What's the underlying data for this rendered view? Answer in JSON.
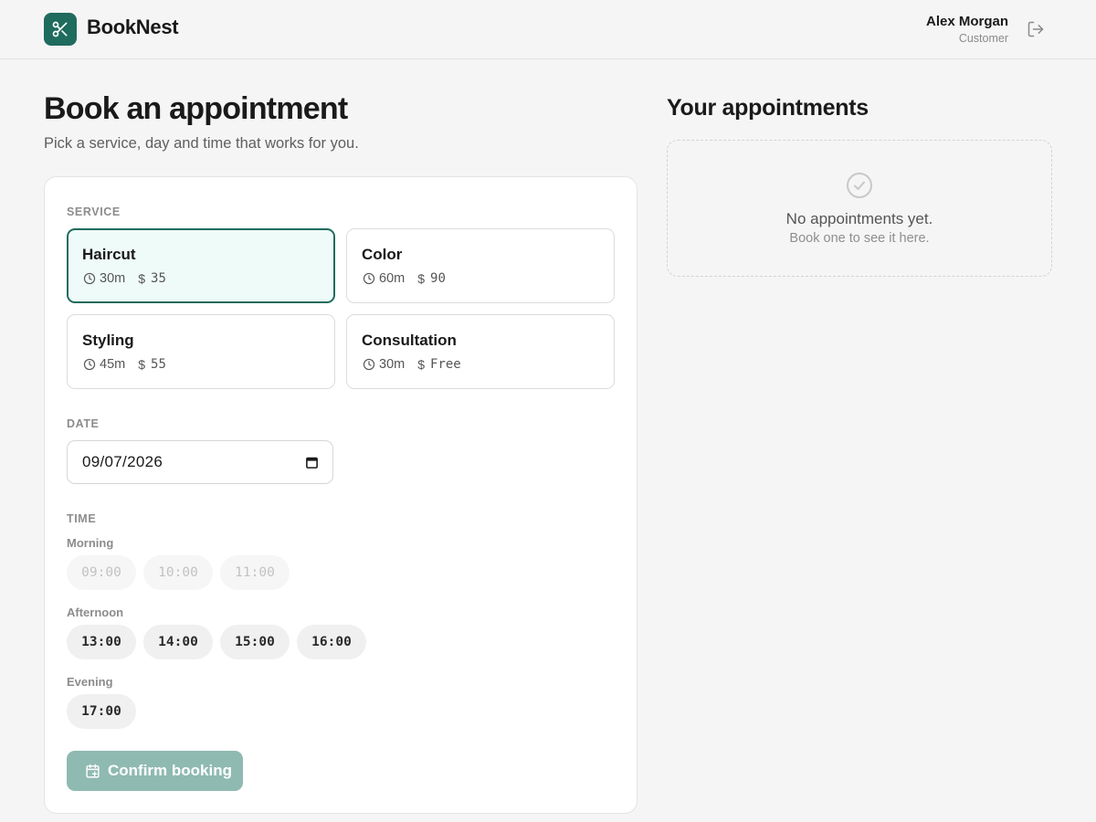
{
  "app": {
    "brand": "BookNest"
  },
  "user": {
    "name": "Alex Morgan",
    "role": "Customer"
  },
  "page": {
    "title": "Book an appointment",
    "subtitle": "Pick a service, day and time that works for you."
  },
  "booking": {
    "service_label": "SERVICE",
    "services": [
      {
        "name": "Haircut",
        "duration": "30m",
        "price": "35",
        "selected": true
      },
      {
        "name": "Color",
        "duration": "60m",
        "price": "90",
        "selected": false
      },
      {
        "name": "Styling",
        "duration": "45m",
        "price": "55",
        "selected": false
      },
      {
        "name": "Consultation",
        "duration": "30m",
        "price": "Free",
        "selected": false
      }
    ],
    "date_label": "DATE",
    "date_value": "09/07/2026",
    "time_label": "TIME",
    "slot_groups": [
      {
        "name": "Morning",
        "slots": [
          {
            "time": "09:00",
            "available": false
          },
          {
            "time": "10:00",
            "available": false
          },
          {
            "time": "11:00",
            "available": false
          }
        ]
      },
      {
        "name": "Afternoon",
        "slots": [
          {
            "time": "13:00",
            "available": true
          },
          {
            "time": "14:00",
            "available": true
          },
          {
            "time": "15:00",
            "available": true
          },
          {
            "time": "16:00",
            "available": true
          }
        ]
      },
      {
        "name": "Evening",
        "slots": [
          {
            "time": "17:00",
            "available": true
          }
        ]
      }
    ],
    "confirm_label": "Confirm booking"
  },
  "appointments": {
    "title": "Your appointments",
    "empty_title": "No appointments yet.",
    "empty_subtitle": "Book one to see it here."
  },
  "colors": {
    "accent": "#1f6b5e",
    "selected_bg": "#effbf8",
    "confirm_disabled": "#8fbab1"
  }
}
